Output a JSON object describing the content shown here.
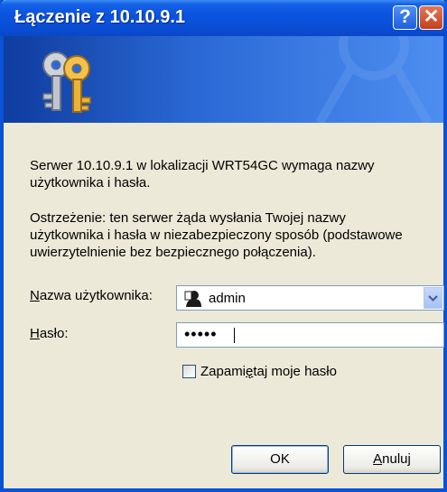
{
  "window": {
    "title": "Łączenie z 10.10.9.1"
  },
  "titlebar": {
    "help_glyph": "?",
    "close_glyph": "✕"
  },
  "icons": {
    "banner": "keys-icon",
    "user": "user-icon",
    "dropdown": "chevron-down-icon"
  },
  "message": {
    "line1": "Serwer 10.10.9.1 w lokalizacji WRT54GC wymaga nazwy użytkownika i hasła.",
    "warning": "Ostrzeżenie: ten serwer żąda wysłania Twojej nazwy użytkownika i hasła w niezabezpieczony sposób (podstawowe uwierzytelnienie bez bezpiecznego połączenia)."
  },
  "form": {
    "username_label_first": "N",
    "username_label_rest": "azwa użytkownika:",
    "username_value": "admin",
    "password_label_first": "H",
    "password_label_rest": "asło:",
    "password_value": "•••••",
    "remember_label_pre": "Zapami",
    "remember_label_ul": "ę",
    "remember_label_post": "taj moje hasło",
    "remember_checked": false
  },
  "buttons": {
    "ok": "OK",
    "cancel_first": "A",
    "cancel_rest": "nuluj"
  },
  "colors": {
    "titlebar": "#0a4fd8",
    "dialog_bg": "#ece9d8",
    "banner": "#2b6ad6"
  }
}
